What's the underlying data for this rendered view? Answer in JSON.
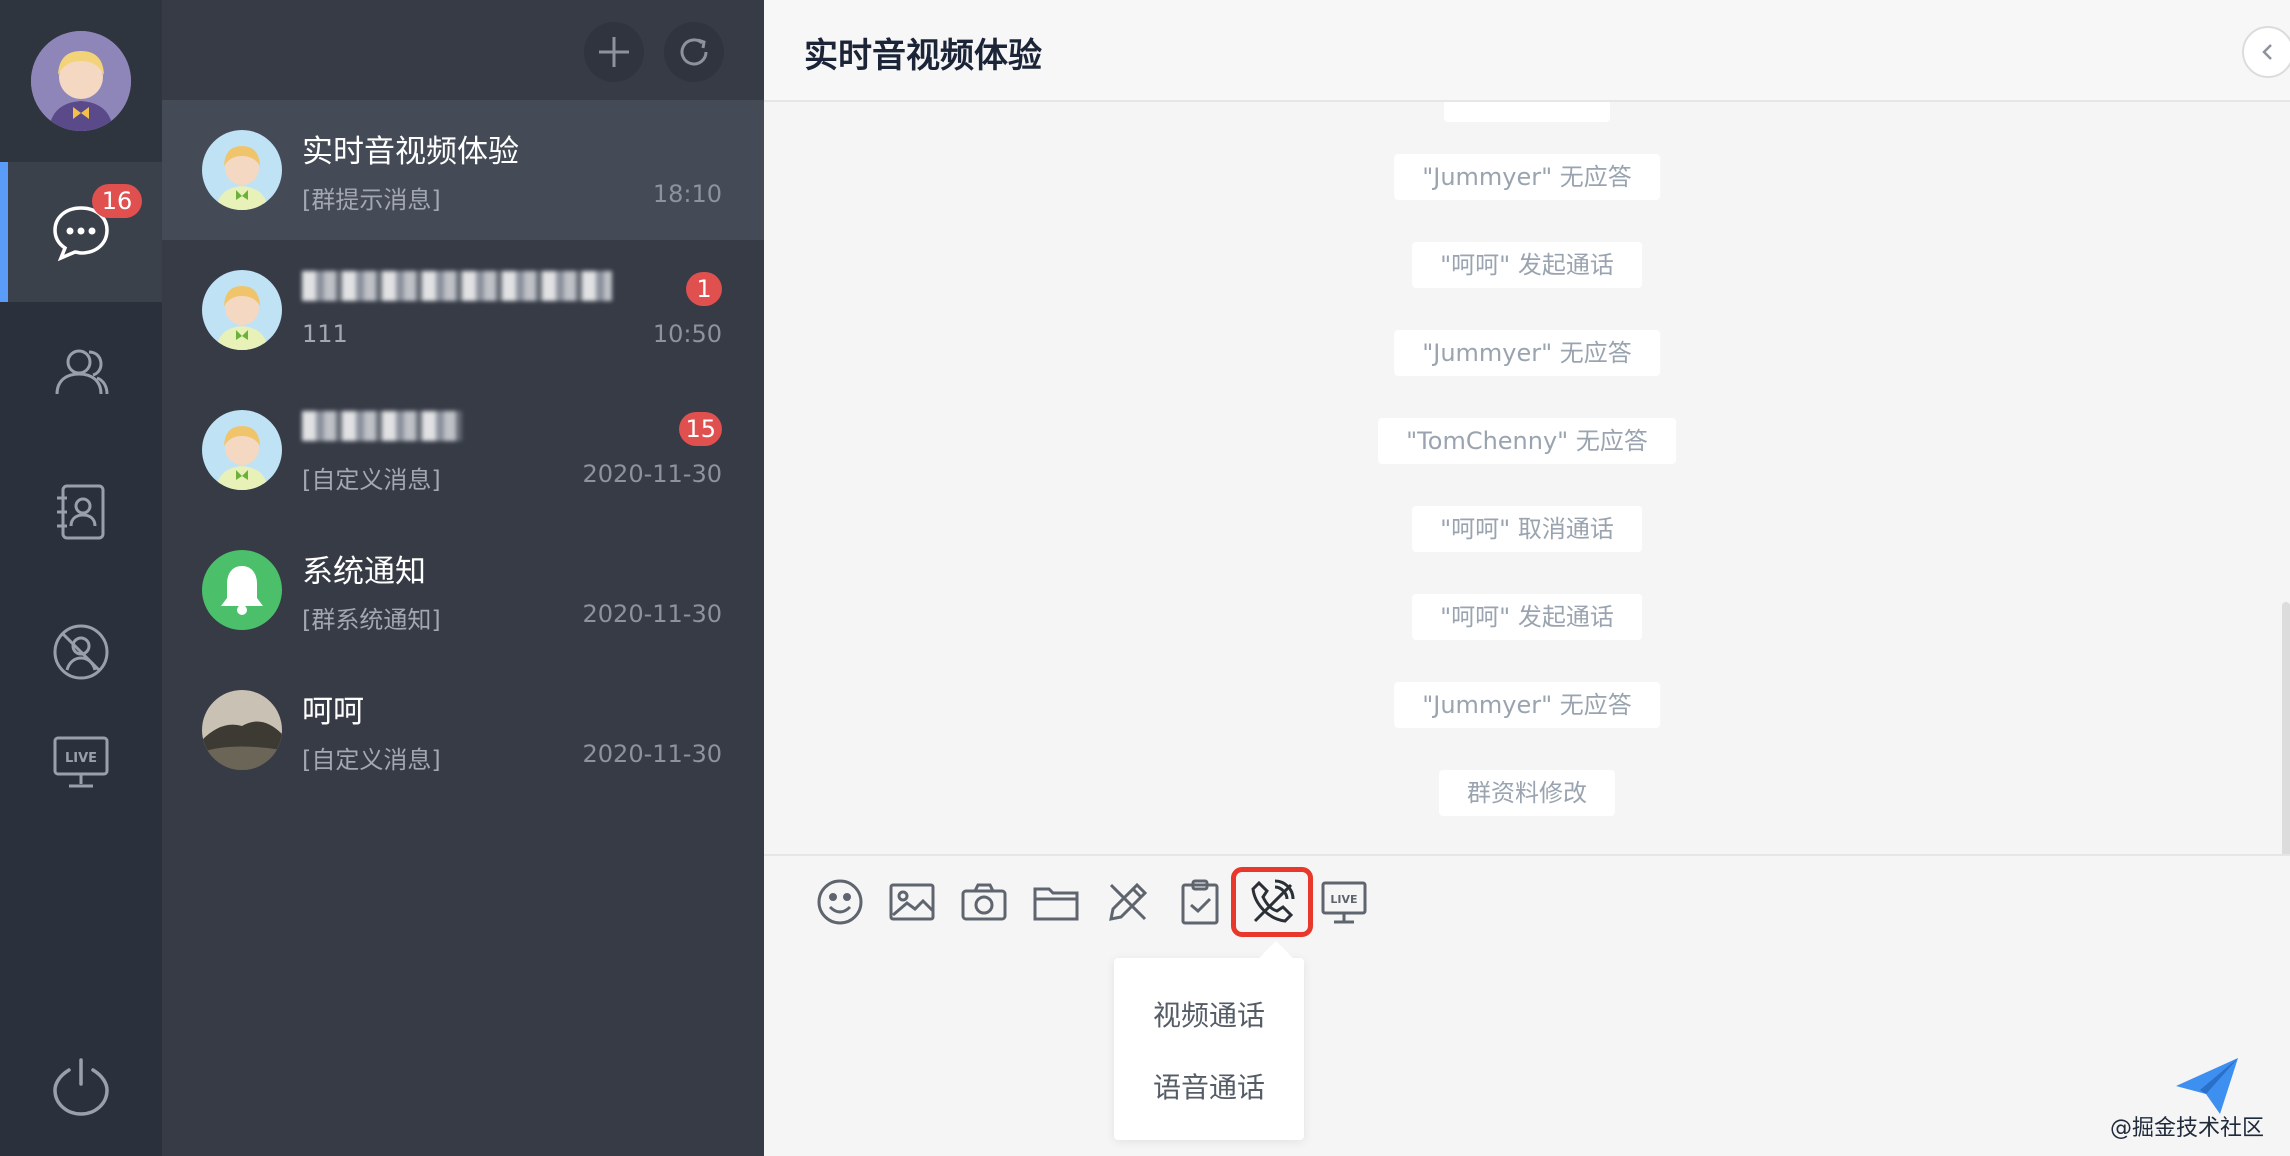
{
  "colors": {
    "accent": "#5a9cf8",
    "badge": "#e0504f",
    "highlight": "#e8382b"
  },
  "rail": {
    "unread_badge": "16",
    "items": [
      {
        "icon": "chat-bubble-icon"
      },
      {
        "icon": "contacts-group-icon"
      },
      {
        "icon": "address-book-icon"
      },
      {
        "icon": "blocked-user-icon"
      },
      {
        "icon": "live-monitor-icon",
        "label": "LIVE"
      },
      {
        "icon": "power-icon"
      }
    ]
  },
  "list_header": {
    "add_icon": "plus-icon",
    "refresh_icon": "refresh-icon"
  },
  "conversations": [
    {
      "name": "实时音视频体验",
      "preview": "[群提示消息]",
      "time": "18:10",
      "badge": ""
    },
    {
      "name": "",
      "preview": "111",
      "time": "10:50",
      "badge": "1"
    },
    {
      "name": "",
      "preview": "[自定义消息]",
      "time": "2020-11-30",
      "badge": "15"
    },
    {
      "name": "系统通知",
      "preview": "[群系统通知]",
      "time": "2020-11-30",
      "badge": ""
    },
    {
      "name": "呵呵",
      "preview": "[自定义消息]",
      "time": "2020-11-30",
      "badge": ""
    }
  ],
  "chat": {
    "title": "实时音视频体验",
    "messages": [
      "\"Jummyer\" 无应答",
      "\"呵呵\" 发起通话",
      "\"Jummyer\" 无应答",
      "\"TomChenny\" 无应答",
      "\"呵呵\" 取消通话",
      "\"呵呵\" 发起通话",
      "\"Jummyer\" 无应答",
      "群资料修改"
    ]
  },
  "toolbar": {
    "tools": [
      "emoji-icon",
      "image-icon",
      "camera-icon",
      "folder-icon",
      "draw-icon",
      "survey-icon",
      "call-icon",
      "live-icon"
    ],
    "live_label": "LIVE"
  },
  "call_menu": {
    "video": "视频通话",
    "voice": "语音通话"
  },
  "watermark": "@掘金技术社区"
}
